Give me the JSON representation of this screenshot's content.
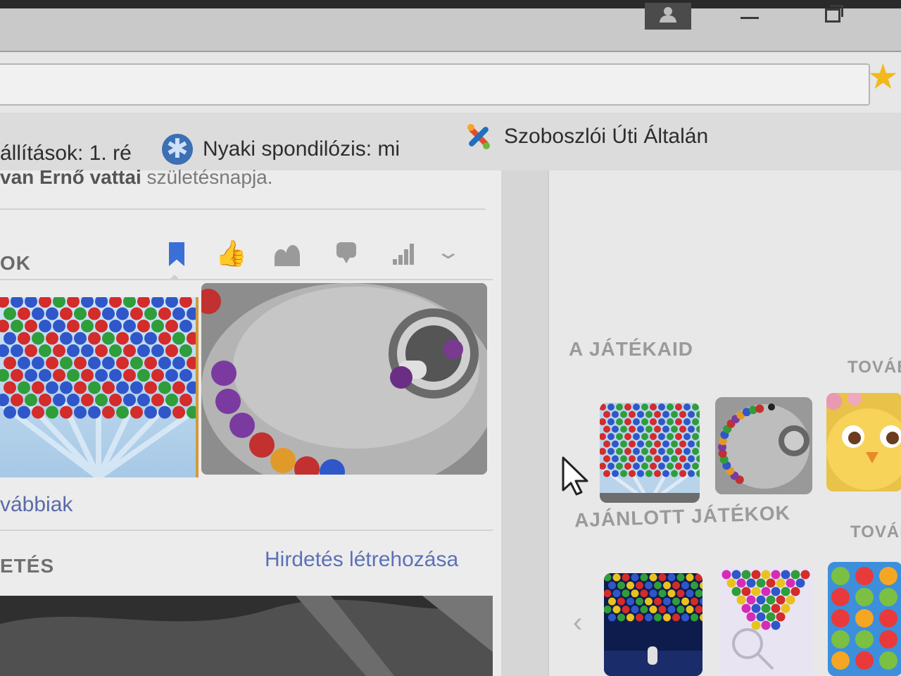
{
  "bookmarks": [
    {
      "label": "állítások: 1. ré",
      "icon": "none"
    },
    {
      "label": "Nyaki spondilózis: mi",
      "icon": "snowflake-favicon"
    },
    {
      "label": "Szoboszlói Úti Általán",
      "icon": "joomla-favicon"
    }
  ],
  "post": {
    "cut_text_bold": "van Ernő vattai",
    "cut_text": " születésnapja."
  },
  "games_panel": {
    "label": "OK",
    "more_link": "vábbiak"
  },
  "ads": {
    "label": "ETÉS",
    "create_link": "Hirdetés létrehozása"
  },
  "sidebar": {
    "your_games_title": "A JÁTÉKAID",
    "your_games_more": "TOVÁB",
    "recommended_title": "AJÁNLOTT JÁTÉKOK",
    "recommended_more": "TOVÁB"
  },
  "colors": {
    "accent_blue": "#3b6fd8",
    "link_blue": "#5b71b8",
    "star": "#f1b91a"
  }
}
